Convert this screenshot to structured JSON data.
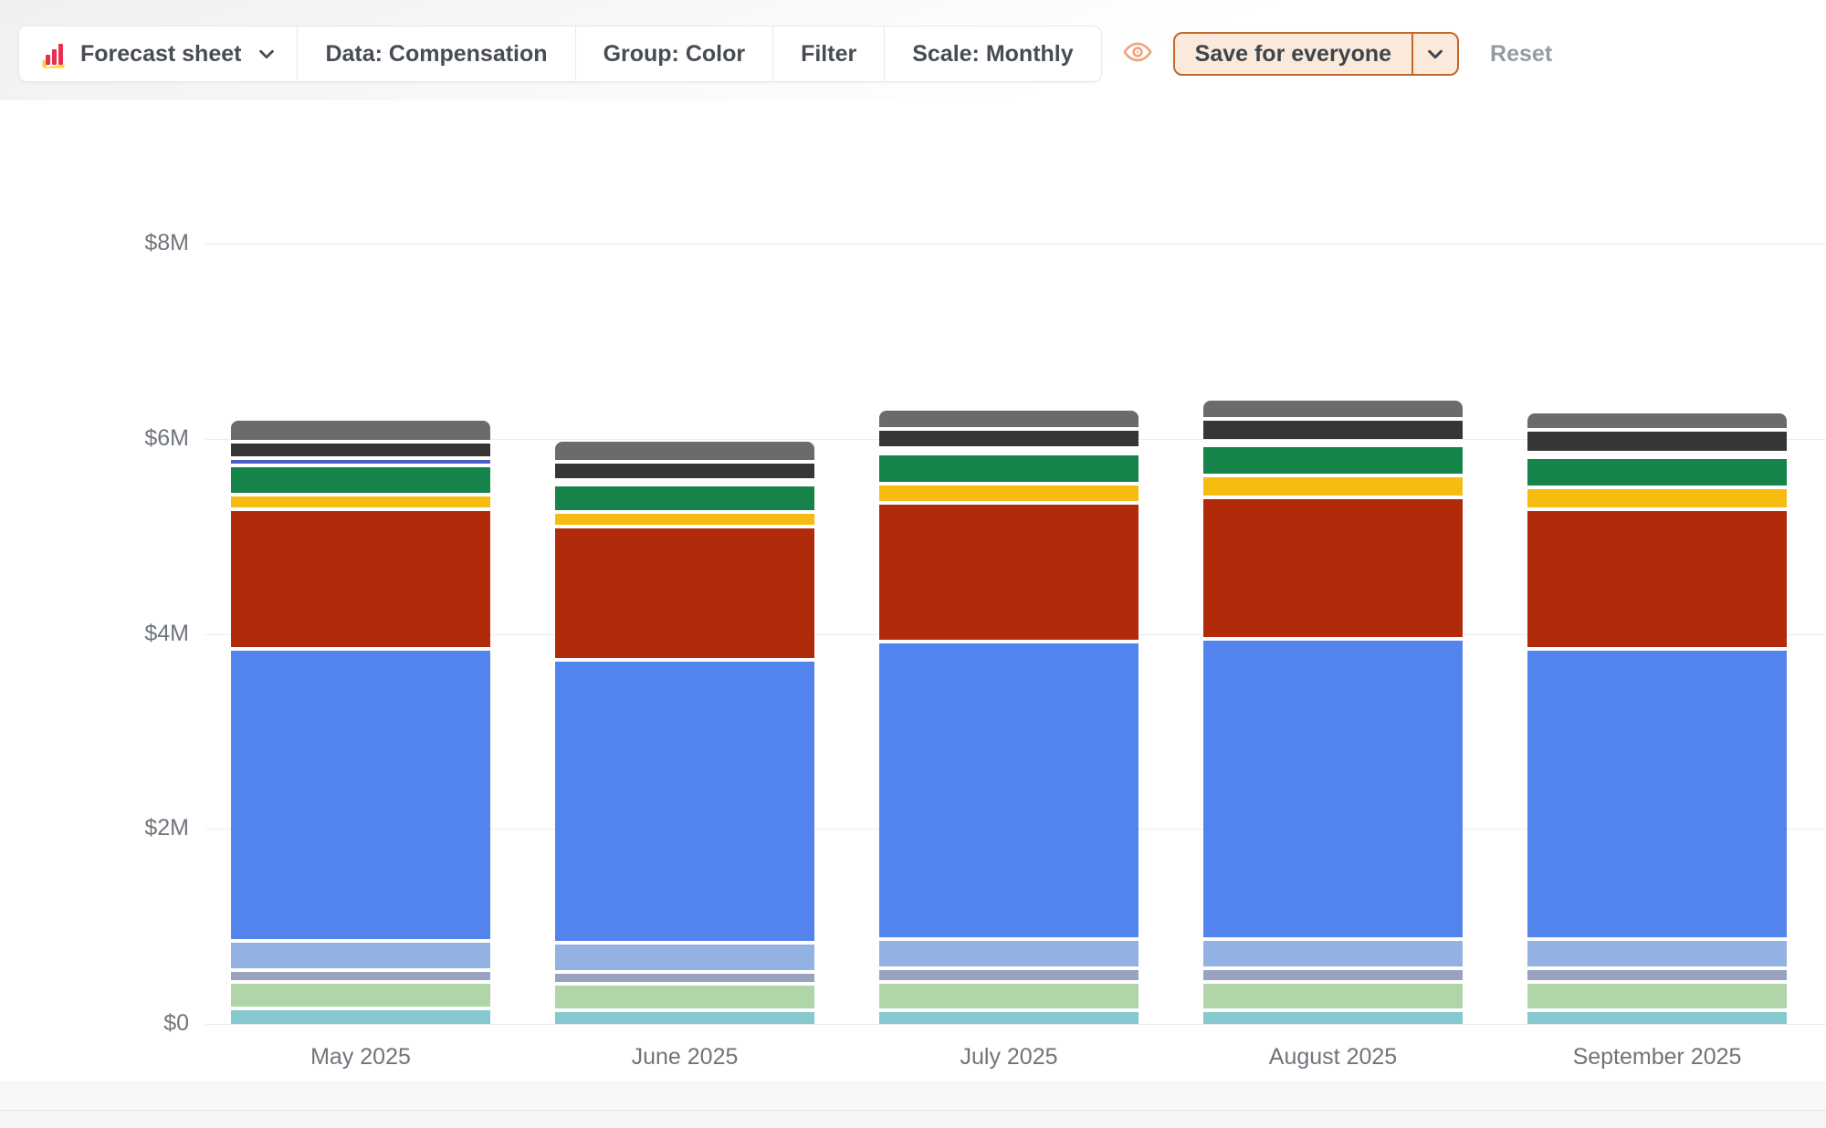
{
  "toolbar": {
    "sheet_selector": {
      "label": "Forecast sheet"
    },
    "segments": [
      {
        "label": "Data: Compensation"
      },
      {
        "label": "Group: Color"
      },
      {
        "label": "Filter"
      },
      {
        "label": "Scale: Monthly"
      }
    ],
    "save_button": {
      "label": "Save for everyone"
    },
    "reset_label": "Reset",
    "accent_color": "#c4672b",
    "logo_colors": {
      "red": "#e8304f",
      "yellow": "#ffd43b"
    },
    "eye_icon_color": "#eda57f"
  },
  "chart_data": {
    "type": "bar",
    "stacked": true,
    "title": "",
    "xlabel": "",
    "ylabel": "",
    "unit": "USD millions",
    "ylim": [
      0,
      8
    ],
    "grid": true,
    "legend": "none",
    "y_ticks": [
      {
        "label": "$8M",
        "value": 8
      },
      {
        "label": "$6M",
        "value": 6
      },
      {
        "label": "$4M",
        "value": 4
      },
      {
        "label": "$2M",
        "value": 2
      },
      {
        "label": "$0",
        "value": 0
      }
    ],
    "categories": [
      "May 2025",
      "June 2025",
      "July 2025",
      "August 2025",
      "September 2025"
    ],
    "totals": [
      6.2,
      5.99,
      6.31,
      6.41,
      6.28
    ],
    "series": [
      {
        "name": "Teal",
        "color": "#85c8ce",
        "values": [
          0.16,
          0.14,
          0.14,
          0.14,
          0.14
        ]
      },
      {
        "name": "Light green",
        "color": "#afd5a8",
        "values": [
          0.27,
          0.27,
          0.29,
          0.29,
          0.29
        ]
      },
      {
        "name": "Slate blue",
        "color": "#99a3bf",
        "values": [
          0.12,
          0.12,
          0.14,
          0.14,
          0.14
        ]
      },
      {
        "name": "Light blue",
        "color": "#94b1e3",
        "values": [
          0.3,
          0.3,
          0.3,
          0.3,
          0.3
        ]
      },
      {
        "name": "Blue",
        "color": "#5383ec",
        "values": [
          3.0,
          2.9,
          3.05,
          3.08,
          2.98
        ]
      },
      {
        "name": "Dark red",
        "color": "#b12b0b",
        "values": [
          1.43,
          1.37,
          1.42,
          1.45,
          1.43
        ]
      },
      {
        "name": "Yellow",
        "color": "#f7bc11",
        "values": [
          0.15,
          0.15,
          0.2,
          0.22,
          0.22
        ]
      },
      {
        "name": "Green",
        "color": "#15834a",
        "values": [
          0.3,
          0.28,
          0.31,
          0.31,
          0.31
        ]
      },
      {
        "name": "Indigo",
        "color": "#4a5fc8",
        "values": [
          0.07,
          0.05,
          0.05,
          0.05,
          0.05
        ]
      },
      {
        "name": "Dark gray",
        "color": "#363636",
        "values": [
          0.17,
          0.18,
          0.2,
          0.22,
          0.23
        ]
      },
      {
        "name": "Gray",
        "color": "#6b6b6b",
        "values": [
          0.23,
          0.23,
          0.21,
          0.21,
          0.19
        ]
      }
    ]
  }
}
